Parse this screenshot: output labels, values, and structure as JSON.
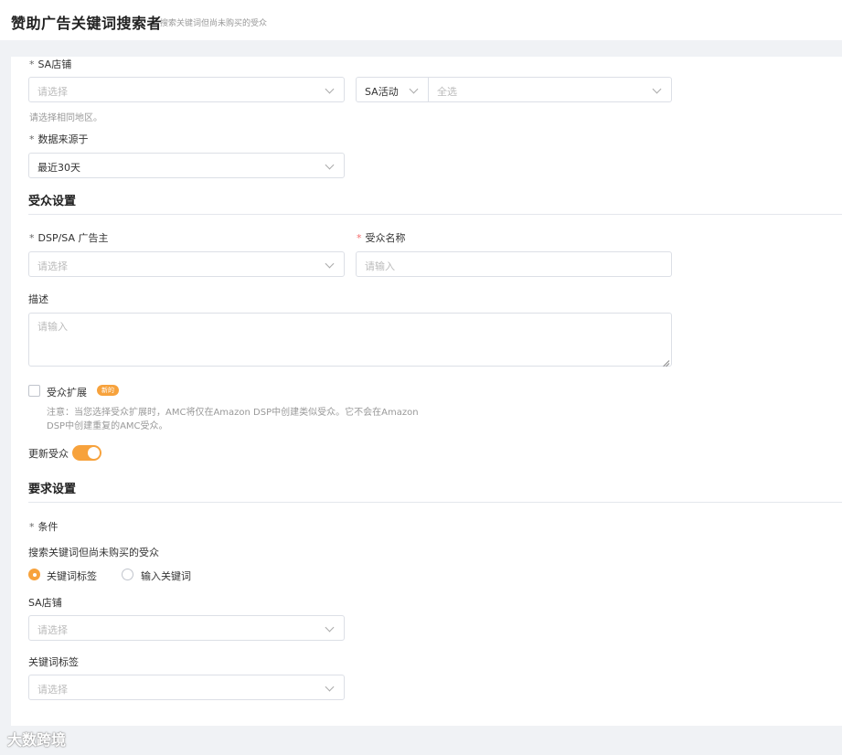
{
  "header": {
    "title": "赞助广告关键词搜索者",
    "subtitle": "搜索关键词但尚未购买的受众"
  },
  "form": {
    "sa_store": {
      "label": "SA店铺",
      "placeholder": "请选择",
      "hint": "请选择相同地区。"
    },
    "sa_activity": {
      "label": "SA活动",
      "value": "全选"
    },
    "data_source": {
      "label": "数据来源于",
      "value": "最近30天"
    },
    "audience_section": {
      "title": "受众设置",
      "advertiser_label": "DSP/SA 广告主",
      "advertiser_placeholder": "请选择",
      "name_label": "受众名称",
      "name_placeholder": "请输入",
      "desc_label": "描述",
      "desc_placeholder": "请输入",
      "expand_label": "受众扩展",
      "expand_badge": "新的",
      "expand_note_line1": "注意：当您选择受众扩展时，AMC将仅在Amazon DSP中创建类似受众。它不会在Amazon",
      "expand_note_line2": "DSP中创建重复的AMC受众。",
      "refresh_label": "更新受众",
      "refresh_on": true
    },
    "requirement_section": {
      "title": "要求设置",
      "condition_label": "条件",
      "condition_desc": "搜索关键词但尚未购买的受众",
      "radio_options": [
        "关键词标签",
        "输入关键词"
      ],
      "radio_selected": 0,
      "sa_store_label": "SA店铺",
      "sa_store_placeholder": "请选择",
      "keyword_tag_label": "关键词标签",
      "keyword_tag_placeholder": "请选择"
    },
    "required_mark": "*"
  },
  "watermark": "大数跨境",
  "colors": {
    "accent": "#f7a23c",
    "required": "#f56c6c",
    "border": "#dcdfe6",
    "background": "#f0f2f5"
  }
}
